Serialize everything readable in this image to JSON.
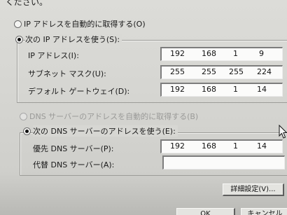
{
  "header_fragment": "ください。",
  "ip": {
    "auto_option": "IP アドレスを自動的に取得する(O)",
    "manual_option": "次の IP アドレスを使う(S):",
    "fields": [
      {
        "label": "IP アドレス(I):",
        "octets": [
          "192",
          "168",
          "1",
          "9"
        ]
      },
      {
        "label": "サブネット マスク(U):",
        "octets": [
          "255",
          "255",
          "255",
          "224"
        ]
      },
      {
        "label": "デフォルト ゲートウェイ(D):",
        "octets": [
          "192",
          "168",
          "1",
          "14"
        ]
      }
    ]
  },
  "dns": {
    "auto_option": "DNS サーバーのアドレスを自動的に取得する(B)",
    "manual_option": "次の DNS サーバーのアドレスを使う(E):",
    "fields": [
      {
        "label": "優先 DNS サーバー(P):",
        "octets": [
          "192",
          "168",
          "1",
          "14"
        ]
      },
      {
        "label": "代替 DNS サーバー(A):",
        "octets": [
          "",
          "",
          "",
          ""
        ]
      }
    ]
  },
  "buttons": {
    "advanced": "詳細設定(V)...",
    "ok": "OK",
    "cancel": "キャンセル"
  }
}
